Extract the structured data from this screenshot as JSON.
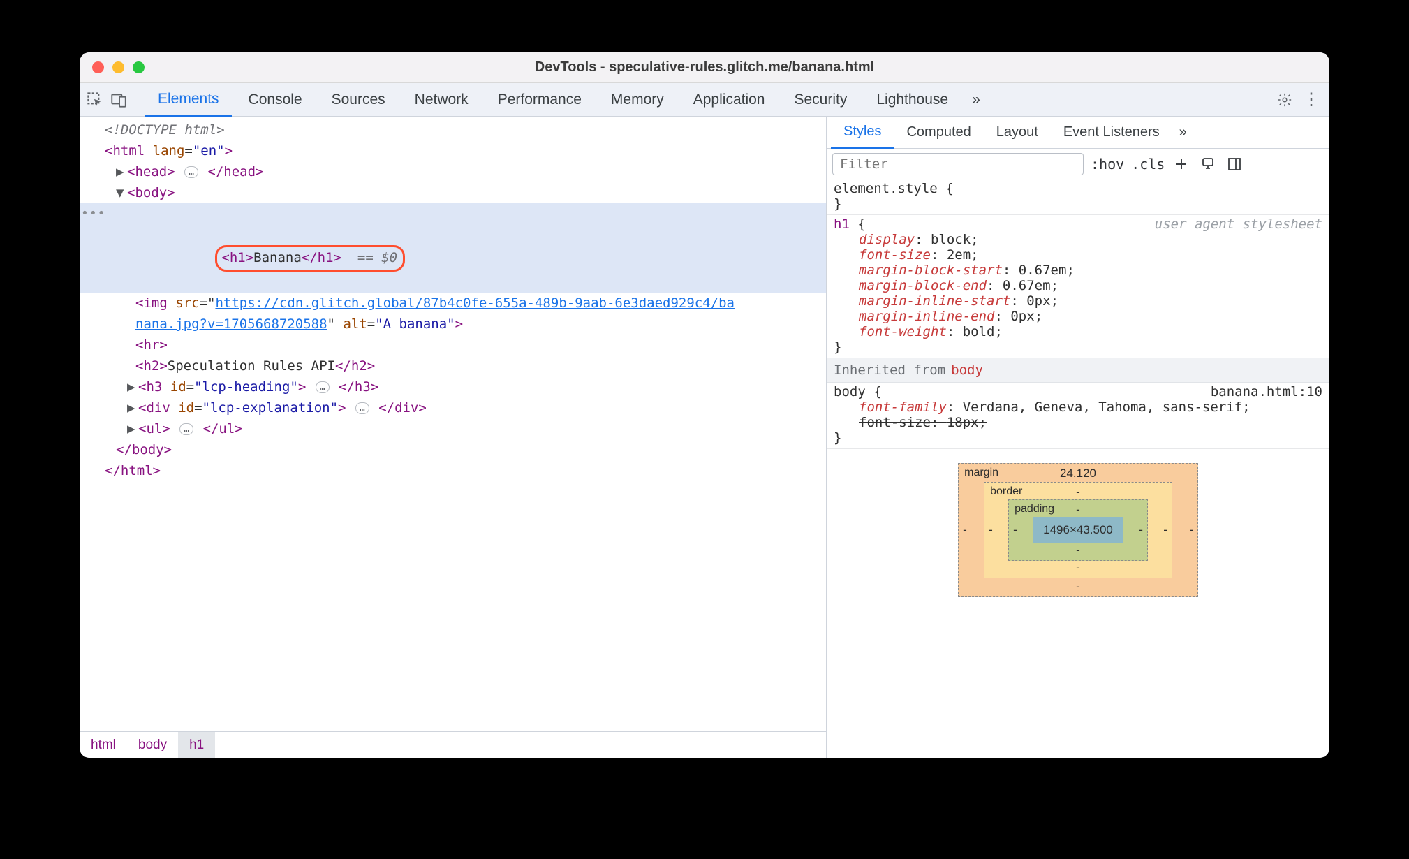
{
  "window": {
    "title": "DevTools - speculative-rules.glitch.me/banana.html"
  },
  "tabs": {
    "items": [
      "Elements",
      "Console",
      "Sources",
      "Network",
      "Performance",
      "Memory",
      "Application",
      "Security",
      "Lighthouse"
    ],
    "more_glyph": "»",
    "active_index": 0
  },
  "dom": {
    "doctype": "<!DOCTYPE html>",
    "html_open": {
      "tag": "html",
      "attr_name": "lang",
      "attr_value": "\"en\""
    },
    "head": {
      "open": "<head>",
      "close": "</head>"
    },
    "body_open": "<body>",
    "h1": {
      "open": "<h1>",
      "text": "Banana",
      "close": "</h1>",
      "ref": "== $0"
    },
    "img": {
      "tag_open": "<img",
      "src_name": "src",
      "src_line1": "https://cdn.glitch.global/87b4c0fe-655a-489b-9aab-6e3daed929c4/ba",
      "src_line2": "nana.jpg?v=1705668720588",
      "alt_name": "alt",
      "alt_value": "\"A banana\"",
      "tag_close": ">"
    },
    "hr": "<hr>",
    "h2": {
      "open": "<h2>",
      "text": "Speculation Rules API",
      "close": "</h2>"
    },
    "h3": {
      "open": "<h3 ",
      "id_name": "id",
      "id_value": "\"lcp-heading\"",
      "open_end": ">",
      "close": "</h3>"
    },
    "div": {
      "open": "<div ",
      "id_name": "id",
      "id_value": "\"lcp-explanation\"",
      "open_end": ">",
      "close": "</div>"
    },
    "ul": {
      "open": "<ul>",
      "close": "</ul>"
    },
    "body_close": "</body>",
    "html_close": "</html>",
    "pill": "…",
    "gutter_dots": "•••"
  },
  "breadcrumbs": [
    "html",
    "body",
    "h1"
  ],
  "sidetabs": {
    "items": [
      "Styles",
      "Computed",
      "Layout",
      "Event Listeners"
    ],
    "more_glyph": "»",
    "active_index": 0
  },
  "toolbar": {
    "filter_placeholder": "Filter",
    "hov": ":hov",
    "cls": ".cls"
  },
  "styles": {
    "element_style_sel": "element.style",
    "h1_sel": "h1",
    "ua_note": "user agent stylesheet",
    "h1_props": [
      {
        "n": "display",
        "v": "block"
      },
      {
        "n": "font-size",
        "v": "2em"
      },
      {
        "n": "margin-block-start",
        "v": "0.67em"
      },
      {
        "n": "margin-block-end",
        "v": "0.67em"
      },
      {
        "n": "margin-inline-start",
        "v": "0px"
      },
      {
        "n": "margin-inline-end",
        "v": "0px"
      },
      {
        "n": "font-weight",
        "v": "bold"
      }
    ],
    "inherited_label": "Inherited from",
    "inherited_from": "body",
    "body_sel": "body",
    "body_src": "banana.html:10",
    "body_props": [
      {
        "n": "font-family",
        "v": "Verdana, Geneva, Tahoma, sans-serif",
        "strike": false
      },
      {
        "n": "font-size",
        "v": "18px",
        "strike": true
      }
    ]
  },
  "boxmodel": {
    "margin": {
      "label": "margin",
      "top": "24.120",
      "right": "-",
      "bottom": "-",
      "left": "-"
    },
    "border": {
      "label": "border",
      "top": "-",
      "right": "-",
      "bottom": "-",
      "left": "-"
    },
    "padding": {
      "label": "padding",
      "top": "-",
      "right": "-",
      "bottom": "-",
      "left": "-"
    },
    "content": "1496×43.500"
  }
}
